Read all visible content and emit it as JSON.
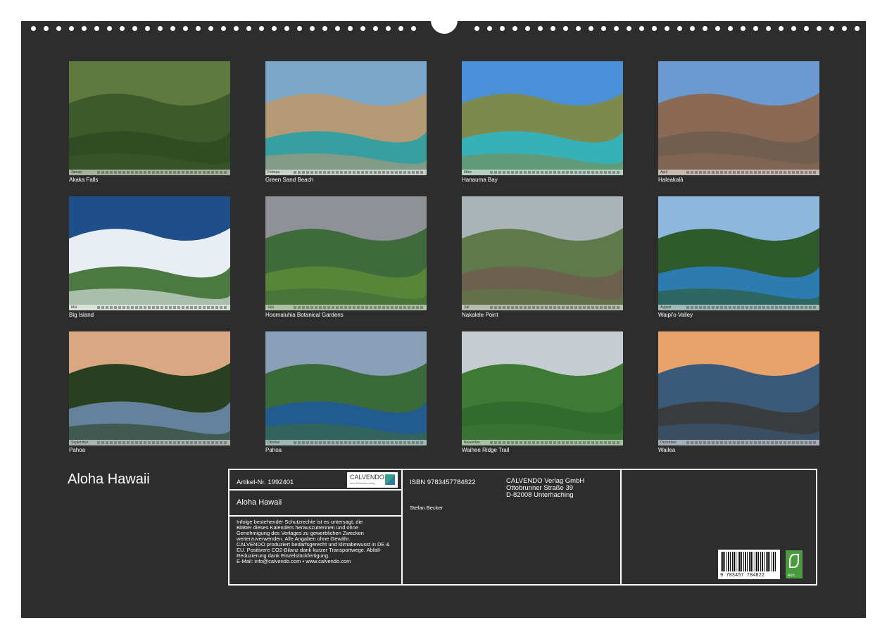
{
  "photos": [
    {
      "month": "Januar",
      "caption": "Akaka Falls",
      "colors": [
        "#5f7a3e",
        "#3c5a2a",
        "#2e4a22"
      ]
    },
    {
      "month": "Februar",
      "caption": "Green Sand Beach",
      "colors": [
        "#7aa6c9",
        "#b39a74",
        "#2aa0a5"
      ]
    },
    {
      "month": "März",
      "caption": "Hanauma Bay",
      "colors": [
        "#4a90d8",
        "#7c8a4e",
        "#2fb5c4"
      ]
    },
    {
      "month": "April",
      "caption": "Haleakalā",
      "colors": [
        "#6a9ad0",
        "#8a6a55",
        "#6f5d4e"
      ]
    },
    {
      "month": "Mai",
      "caption": "Big Island",
      "colors": [
        "#1f4f8a",
        "#e8eef4",
        "#3b6b2d"
      ]
    },
    {
      "month": "Juni",
      "caption": "Hoomaluhia Botanical Gardens",
      "colors": [
        "#8e9296",
        "#3f6a3b",
        "#5a8a3a"
      ]
    },
    {
      "month": "Juli",
      "caption": "Nakalele Point",
      "colors": [
        "#a9b3b8",
        "#5e7a4a",
        "#6e5e4e"
      ]
    },
    {
      "month": "August",
      "caption": "Waipi'o Valley",
      "colors": [
        "#8cb8de",
        "#2f5a2c",
        "#2c7fc0"
      ]
    },
    {
      "month": "September",
      "caption": "Pahoa",
      "colors": [
        "#d9a882",
        "#28401f",
        "#6a8aa8"
      ]
    },
    {
      "month": "Oktober",
      "caption": "Pahoa",
      "colors": [
        "#8aa0b8",
        "#3a6a3a",
        "#1f5a9a"
      ]
    },
    {
      "month": "November",
      "caption": "Waihee Ridge Trail",
      "colors": [
        "#c5cdd2",
        "#3f7a34",
        "#2e6a2e"
      ]
    },
    {
      "month": "Dezember",
      "caption": "Wailea",
      "colors": [
        "#e9a36a",
        "#3b5a7a",
        "#3a3a38"
      ]
    }
  ],
  "calendar_title": "Aloha Hawaii",
  "info": {
    "article_no": "Artikel-Nr. 1992401",
    "logo_text": "CALVENDO",
    "logo_subtext": "best Kalenderverlag",
    "isbn": "ISBN 9783457784822",
    "publisher_lines": [
      "CALVENDO Verlag GmbH",
      "Ottobrunner Straße 39",
      "D-82008 Unterhaching"
    ],
    "title": "Aloha Hawaii",
    "author": "Stefan Becker",
    "legal_lines": [
      "Infolge bestehender Schutzrechte ist es untersagt, die",
      "Blätter dieses Kalenders herauszutrennen und ohne",
      "Genehmigung des Verlages zu gewerblichen Zwecken",
      "weiterzuverwenden. Alle Angaben ohne Gewähr.",
      "CALVENDO produziert bedarfsgerecht und klimabewusst in DE &",
      "EU. Positivere CO2-Bilanz dank kurzer Transportwege. Abfall-",
      "Reduzierung dank Einzelstückfertigung.",
      "E-Mail: info@calvendo.com • www.calvendo.com"
    ],
    "barcode_number": "9 783457 784822",
    "eco_label": "eco"
  }
}
